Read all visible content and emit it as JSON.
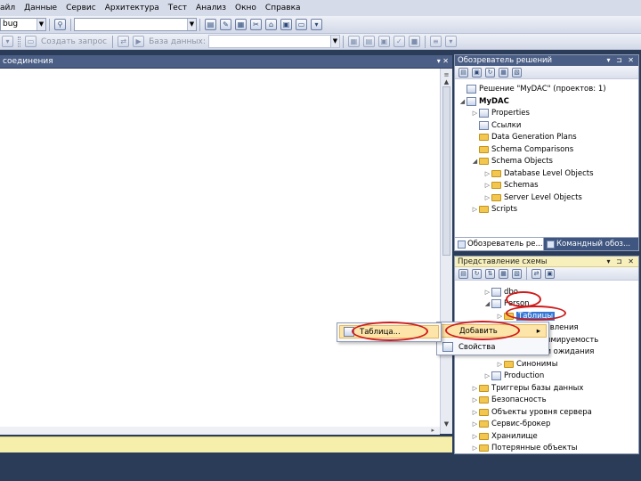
{
  "menubar": {
    "items": [
      "айл",
      "Данные",
      "Сервис",
      "Архитектура",
      "Тест",
      "Анализ",
      "Окно",
      "Справка"
    ]
  },
  "toolbar1": {
    "config_combo": "bug",
    "search_combo": ""
  },
  "toolbar2": {
    "create_query": "Создать запрос",
    "database_label": "База данных:"
  },
  "document": {
    "title": "соединения",
    "pin": "▾ ✕"
  },
  "solution_explorer": {
    "title": "Обозреватель решений",
    "buttons": "▾ ⊐ ✕",
    "items": [
      {
        "label": "Решение \"MyDAC\" (проектов: 1)",
        "level": 0,
        "exp": ""
      },
      {
        "label": "MyDAC",
        "level": 0,
        "exp": "◢",
        "bold": true
      },
      {
        "label": "Properties",
        "level": 1,
        "exp": "▷"
      },
      {
        "label": "Ссылки",
        "level": 1,
        "exp": ""
      },
      {
        "label": "Data Generation Plans",
        "level": 1,
        "exp": ""
      },
      {
        "label": "Schema Comparisons",
        "level": 1,
        "exp": ""
      },
      {
        "label": "Schema Objects",
        "level": 1,
        "exp": "◢"
      },
      {
        "label": "Database Level Objects",
        "level": 2,
        "exp": "▷"
      },
      {
        "label": "Schemas",
        "level": 2,
        "exp": "▷"
      },
      {
        "label": "Server Level Objects",
        "level": 2,
        "exp": "▷"
      },
      {
        "label": "Scripts",
        "level": 1,
        "exp": "▷"
      }
    ],
    "tabs": [
      "Обозреватель ре...",
      "Командный обоз..."
    ]
  },
  "schema_view": {
    "title": "Представление схемы",
    "buttons": "▾ ⊐ ✕",
    "items": [
      {
        "label": "dbo",
        "level": 2,
        "exp": "▷"
      },
      {
        "label": "Person",
        "level": 2,
        "exp": "◢"
      },
      {
        "label": "Таблицы",
        "level": 3,
        "exp": "▷",
        "selected": true
      },
      {
        "label": "Представления",
        "level": 3,
        "exp": "▷"
      },
      {
        "label": "Программируемость",
        "level": 3,
        "exp": "▷"
      },
      {
        "label": "Очереди ожидания",
        "level": 3,
        "exp": "▷"
      },
      {
        "label": "Синонимы",
        "level": 3,
        "exp": "▷"
      },
      {
        "label": "Production",
        "level": 2,
        "exp": "▷"
      },
      {
        "label": "Триггеры базы данных",
        "level": 1,
        "exp": "▷"
      },
      {
        "label": "Безопасность",
        "level": 1,
        "exp": "▷"
      },
      {
        "label": "Объекты уровня сервера",
        "level": 1,
        "exp": "▷"
      },
      {
        "label": "Сервис-брокер",
        "level": 1,
        "exp": "▷"
      },
      {
        "label": "Хранилище",
        "level": 1,
        "exp": "▷"
      },
      {
        "label": "Потерянные объекты",
        "level": 1,
        "exp": "▷"
      }
    ]
  },
  "context_menu_add": {
    "add_label": "Добавить",
    "properties_label": "Свойства",
    "arrow": "▸"
  },
  "context_menu_table": {
    "table_label": "Таблица..."
  },
  "colors": {
    "annotation": "#d01b1b",
    "selection": "#3477d4",
    "title_bar": "#4b5f86"
  }
}
